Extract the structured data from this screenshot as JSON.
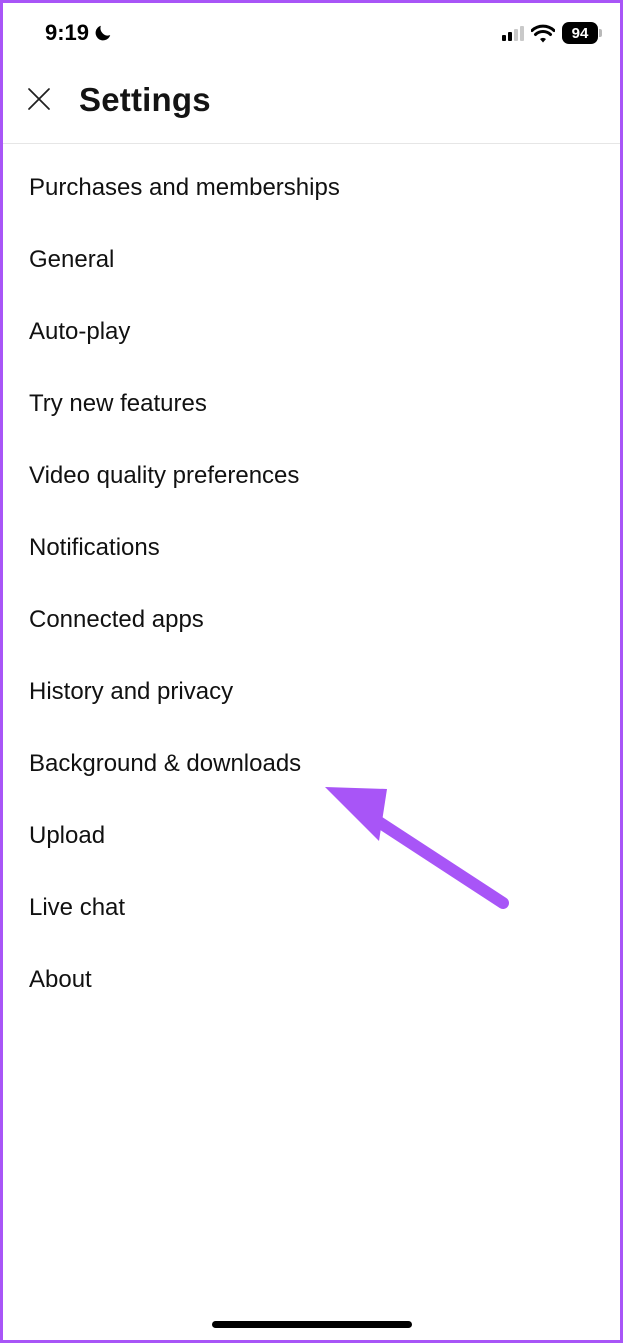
{
  "status": {
    "time": "9:19",
    "battery": "94"
  },
  "header": {
    "title": "Settings"
  },
  "menu": {
    "items": [
      "Purchases and memberships",
      "General",
      "Auto-play",
      "Try new features",
      "Video quality preferences",
      "Notifications",
      "Connected apps",
      "History and privacy",
      "Background & downloads",
      "Upload",
      "Live chat",
      "About"
    ]
  }
}
